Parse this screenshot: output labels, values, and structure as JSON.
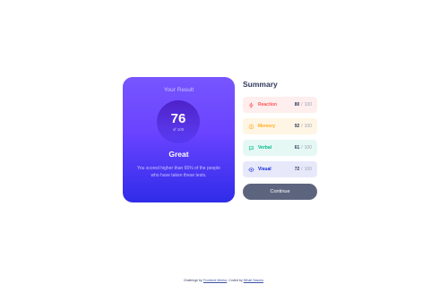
{
  "result": {
    "title": "Your Result",
    "score": "76",
    "out_of": "of 100",
    "rating": "Great",
    "description": "You scored higher than 65% of the people who have taken these tests.",
    "gradient_top": "#7755ff",
    "gradient_bottom": "#2f2ce9"
  },
  "summary": {
    "title": "Summary",
    "items": [
      {
        "label": "Reaction",
        "score": "80",
        "separator": "/",
        "total": "100",
        "icon": "lightning-icon",
        "color": "#ff5757",
        "bg": "#fff6f5"
      },
      {
        "label": "Memory",
        "score": "92",
        "separator": "/",
        "total": "100",
        "icon": "brain-icon",
        "color": "#ffb01f",
        "bg": "#fffbf2"
      },
      {
        "label": "Verbal",
        "score": "61",
        "separator": "/",
        "total": "100",
        "icon": "chat-bubble-icon",
        "color": "#00bb8f",
        "bg": "#f2fcf9"
      },
      {
        "label": "Visual",
        "score": "72",
        "separator": "/",
        "total": "100",
        "icon": "eye-icon",
        "color": "#1125d6",
        "bg": "#f3f3fd"
      }
    ],
    "continue_label": "Continue",
    "continue_color": "#303b5a"
  },
  "attribution": {
    "prefix": "Challenge by",
    "challenge_link": "Frontend Mentor",
    "middle": ". Coded by",
    "author_link": "Mihail Sasoko",
    "suffix": "."
  }
}
